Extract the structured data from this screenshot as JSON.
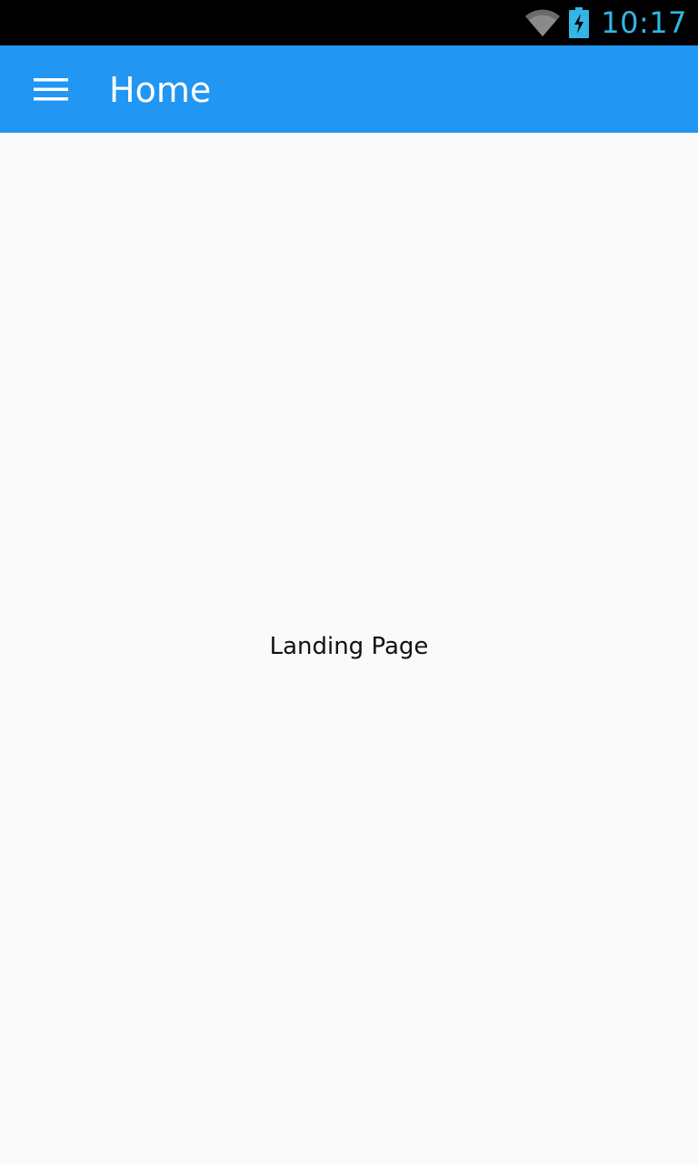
{
  "status_bar": {
    "time": "10:17",
    "icons": [
      "wifi-icon",
      "battery-charging-icon"
    ],
    "time_color": "#33b5e5"
  },
  "app_bar": {
    "title": "Home",
    "menu_icon": "hamburger-menu-icon",
    "background": "#2196f3"
  },
  "main": {
    "text": "Landing Page"
  }
}
